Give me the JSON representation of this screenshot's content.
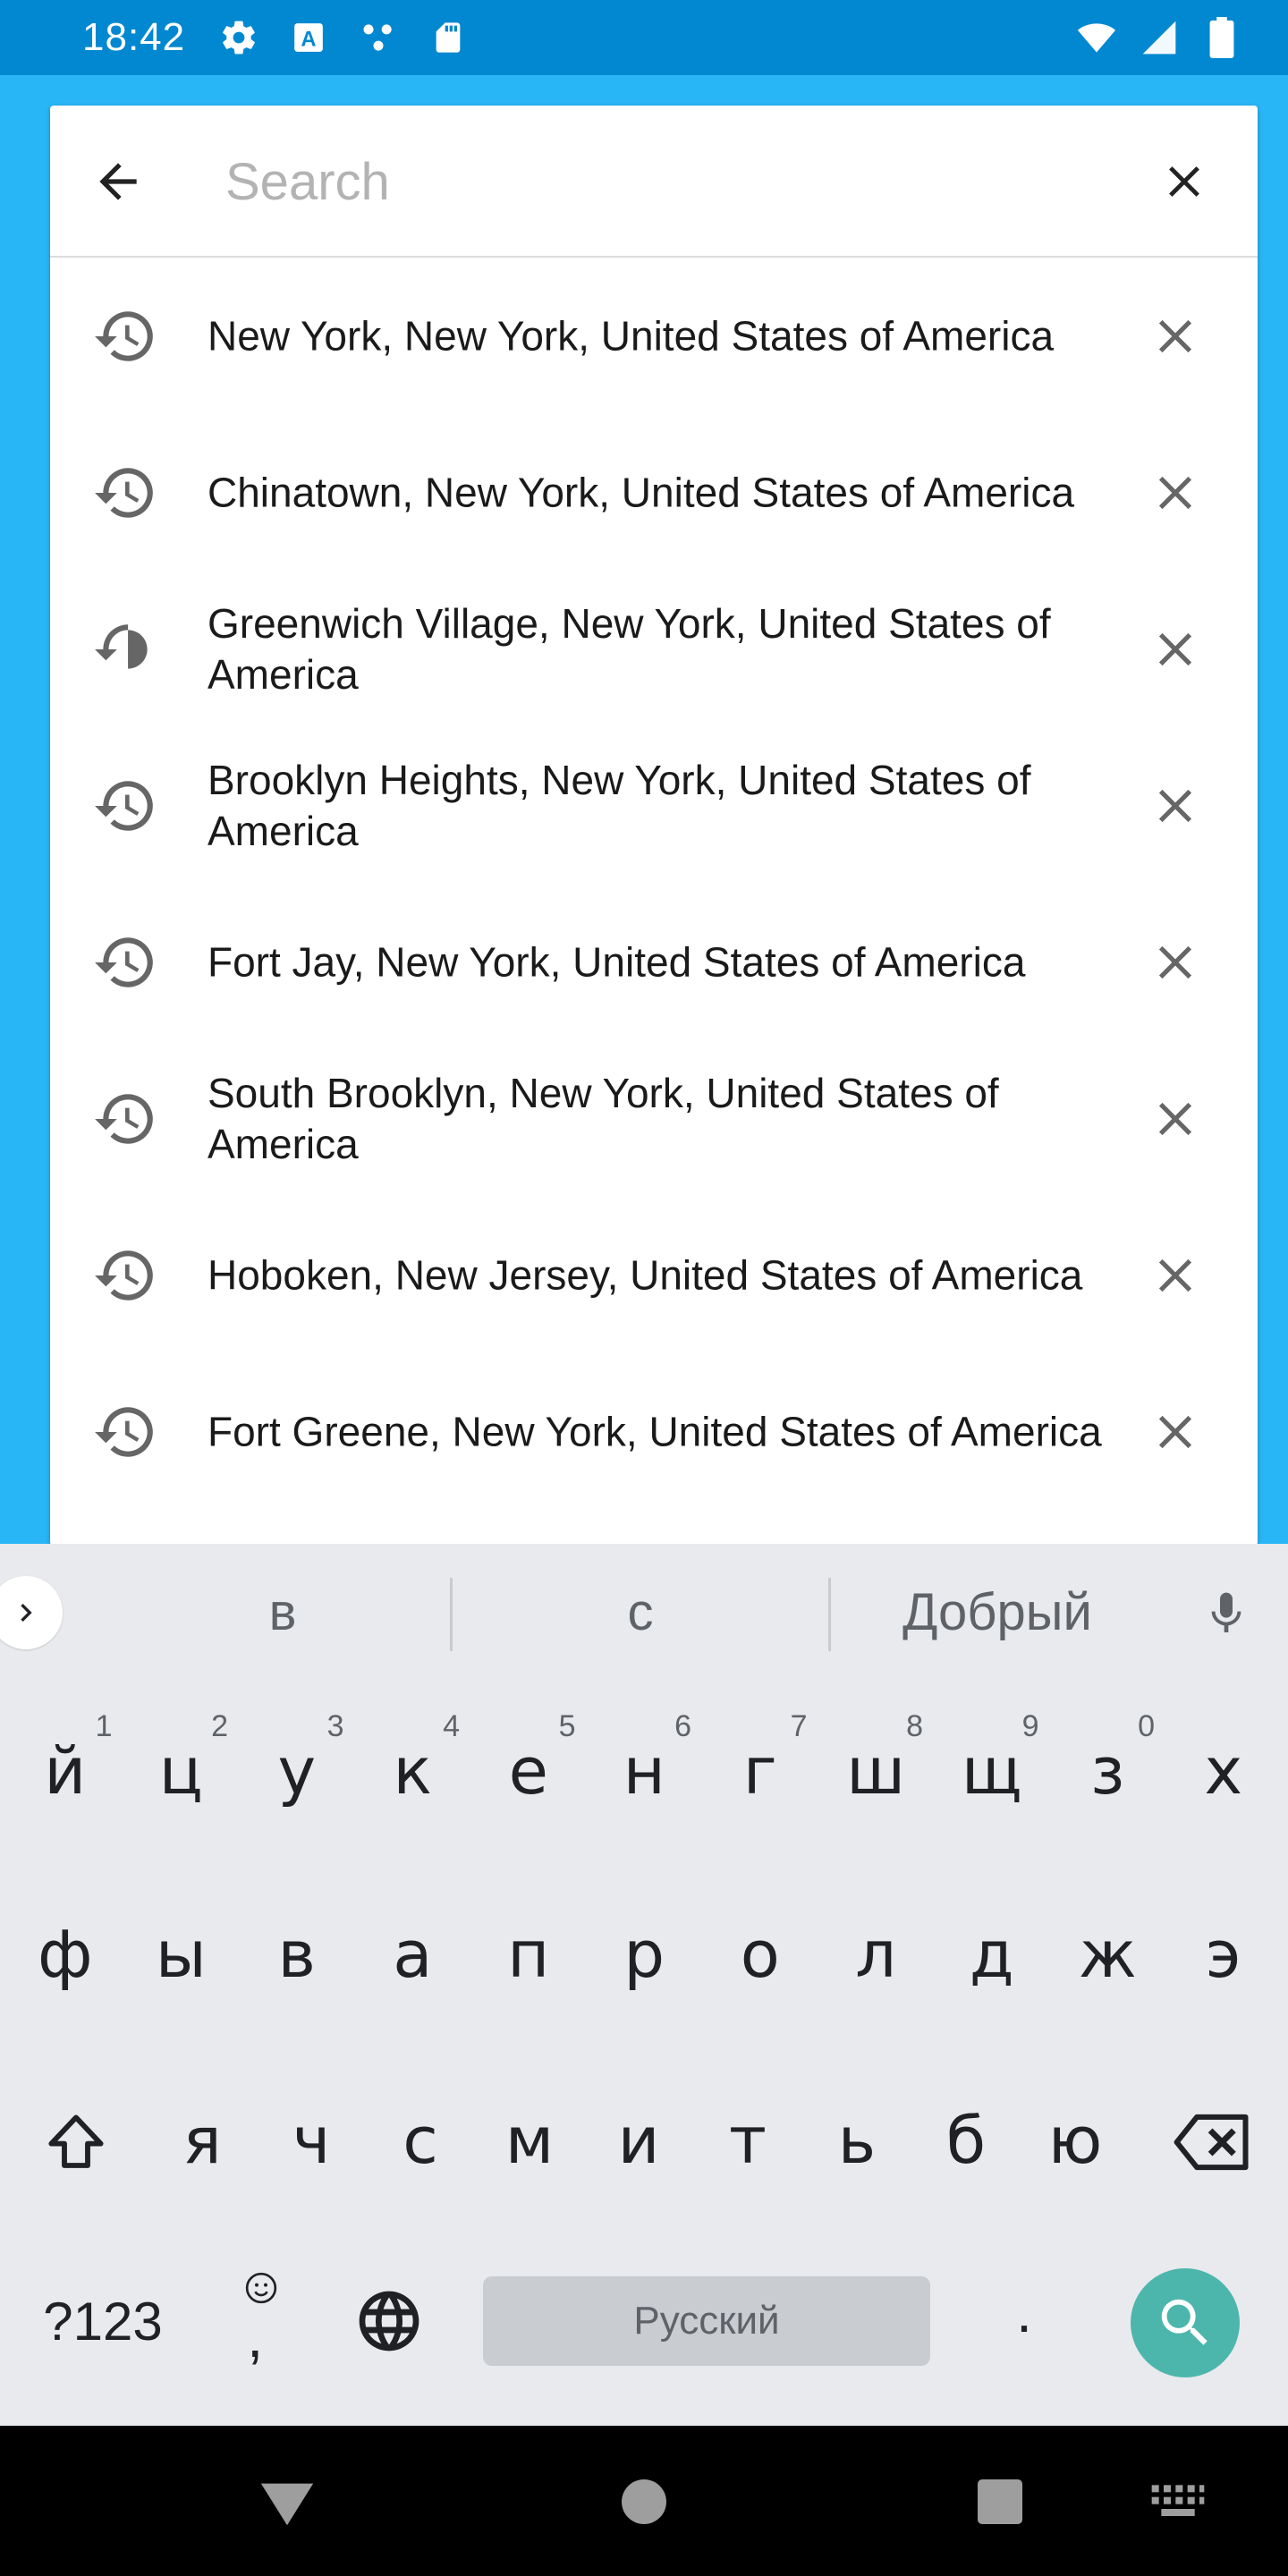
{
  "status_bar": {
    "time": "18:42",
    "left_icons": [
      "settings-icon",
      "text-a-icon",
      "dots-icon",
      "sd-card-icon"
    ],
    "right_icons": [
      "wifi-icon",
      "signal-icon",
      "battery-icon"
    ]
  },
  "search": {
    "placeholder": "Search",
    "value": ""
  },
  "history": [
    {
      "label": "New York, New York, United States of America"
    },
    {
      "label": "Chinatown, New York, United States of America"
    },
    {
      "label": "Greenwich Village, New York, United States of America"
    },
    {
      "label": "Brooklyn Heights, New York, United States of America"
    },
    {
      "label": "Fort Jay, New York, United States of America"
    },
    {
      "label": "South Brooklyn, New York, United States of America"
    },
    {
      "label": "Hoboken, New Jersey, United States of America"
    },
    {
      "label": "Fort Greene, New York, United States of America"
    }
  ],
  "keyboard": {
    "suggestions": [
      "в",
      "с",
      "Добрый"
    ],
    "row1": [
      "й",
      "ц",
      "у",
      "к",
      "е",
      "н",
      "г",
      "ш",
      "щ",
      "з",
      "х"
    ],
    "row1_hints": [
      "1",
      "2",
      "3",
      "4",
      "5",
      "6",
      "7",
      "8",
      "9",
      "0",
      ""
    ],
    "row2": [
      "ф",
      "ы",
      "в",
      "а",
      "п",
      "р",
      "о",
      "л",
      "д",
      "ж",
      "э"
    ],
    "row3": [
      "я",
      "ч",
      "с",
      "м",
      "и",
      "т",
      "ь",
      "б",
      "ю"
    ],
    "symbols_label": "?123",
    "comma_label": ",",
    "period_label": ".",
    "space_label": "Русский"
  },
  "colors": {
    "background": "#29b6f6",
    "status_bar": "#0288d1",
    "search_key": "#4db6ac"
  }
}
